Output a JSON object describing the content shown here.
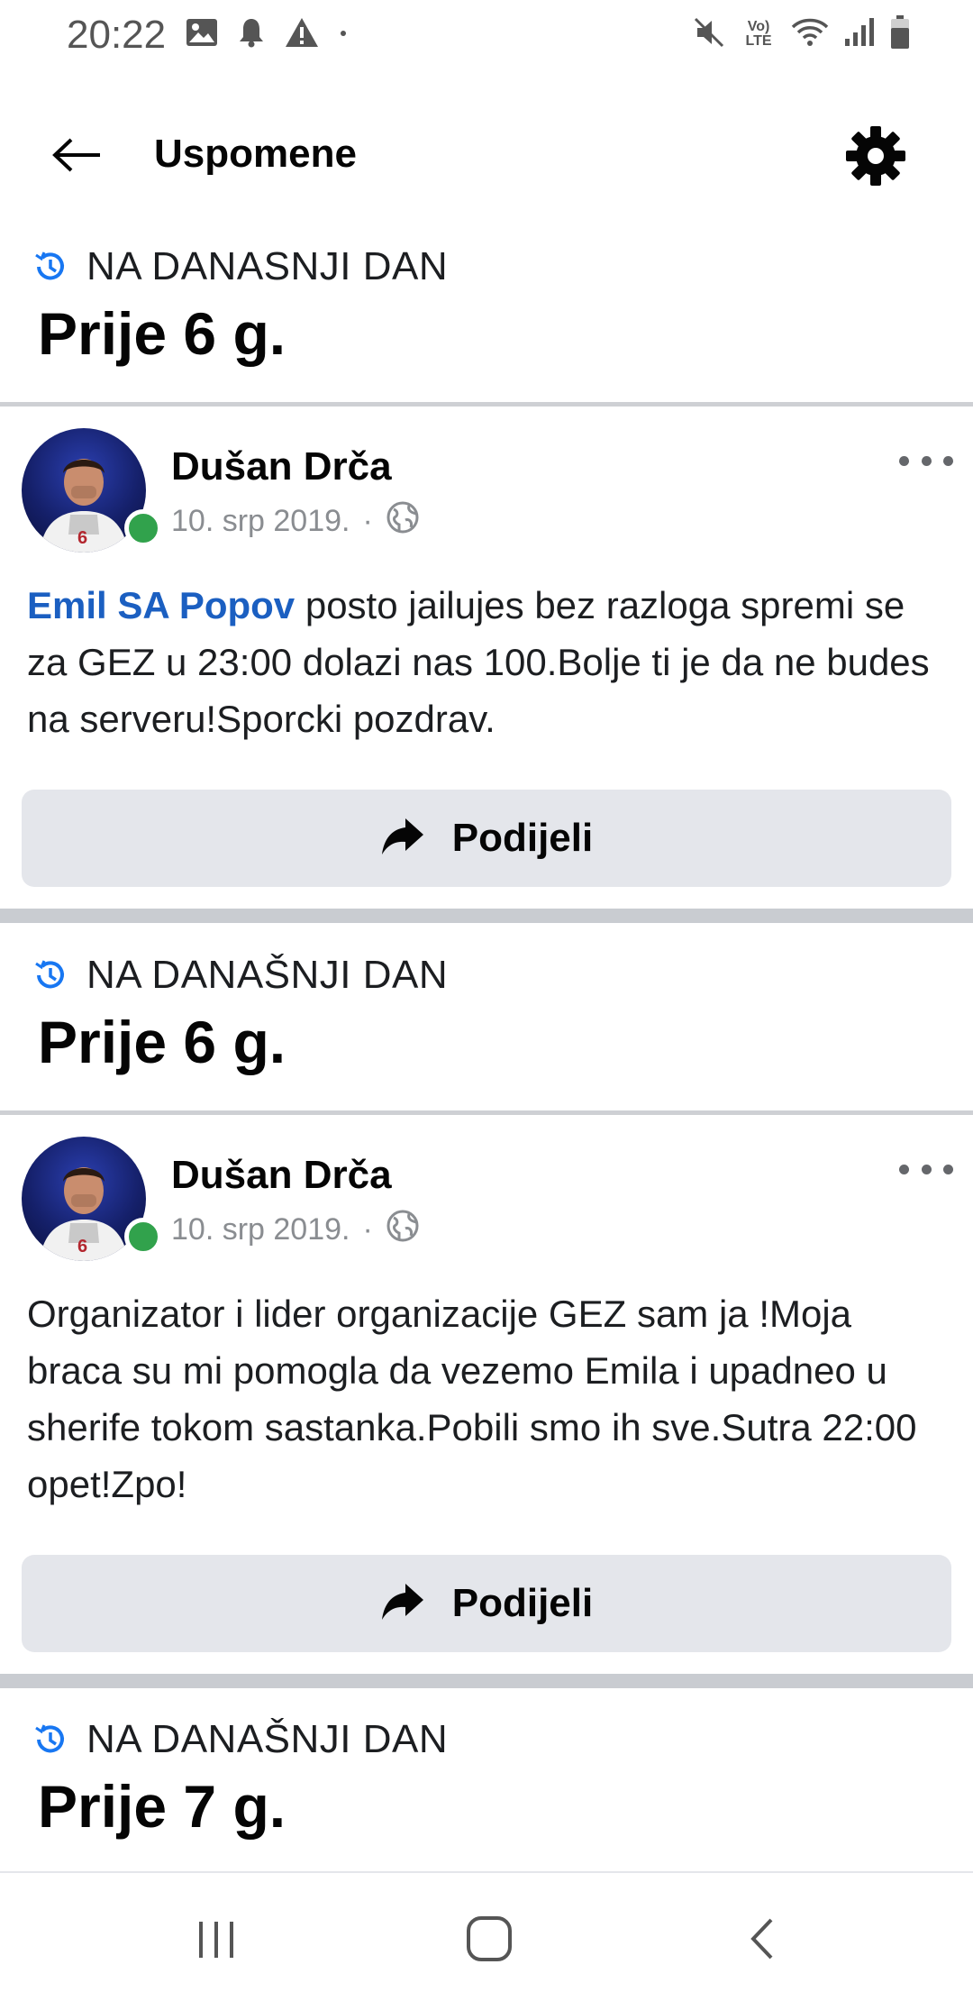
{
  "status_bar": {
    "time": "20:22",
    "left_icons": [
      "image-icon",
      "bell-icon",
      "warning-icon",
      "dot-icon"
    ],
    "right_icons": [
      "mute-icon",
      "volte-icon",
      "wifi-icon",
      "signal-icon",
      "battery-icon"
    ],
    "volte_text": "Vo) LTE"
  },
  "header": {
    "title": "Uspomene",
    "back_icon": "arrow-left-icon",
    "settings_icon": "gear-icon"
  },
  "memories": [
    {
      "label": "NA DANASNJI DAN",
      "ago": "Prije 6 g.",
      "post": {
        "author": "Dušan Drča",
        "date": "10. srp 2019.",
        "separator": "·",
        "privacy_icon": "globe-icon",
        "mention": "Emil SA Popov",
        "text": " posto jailujes bez razloga spremi se za GEZ u 23:00 dolazi nas 100.Bolje ti je da ne budes na serveru!Sporcki pozdrav.",
        "share_label": "Podijeli"
      }
    },
    {
      "label": "NA DANAŠNJI DAN",
      "ago": "Prije 6 g.",
      "post": {
        "author": "Dušan Drča",
        "date": "10. srp 2019.",
        "separator": "·",
        "privacy_icon": "globe-icon",
        "text": "Organizator i lider organizacije GEZ sam ja !Moja braca su mi pomogla da vezemo Emila i upadneo u sherife tokom sastanka.Pobili smo ih sve.Sutra 22:00 opet!Zpo!",
        "share_label": "Podijeli"
      }
    },
    {
      "label": "NA DANAŠNJI DAN",
      "ago": "Prije 7 g."
    }
  ],
  "nav_bar": {
    "buttons": [
      "recent-apps-icon",
      "home-icon",
      "back-icon"
    ]
  },
  "colors": {
    "mention": "#1b5fc1",
    "online": "#31a24c",
    "memory_icon": "#1877f2",
    "share_bg": "#e4e6eb"
  }
}
